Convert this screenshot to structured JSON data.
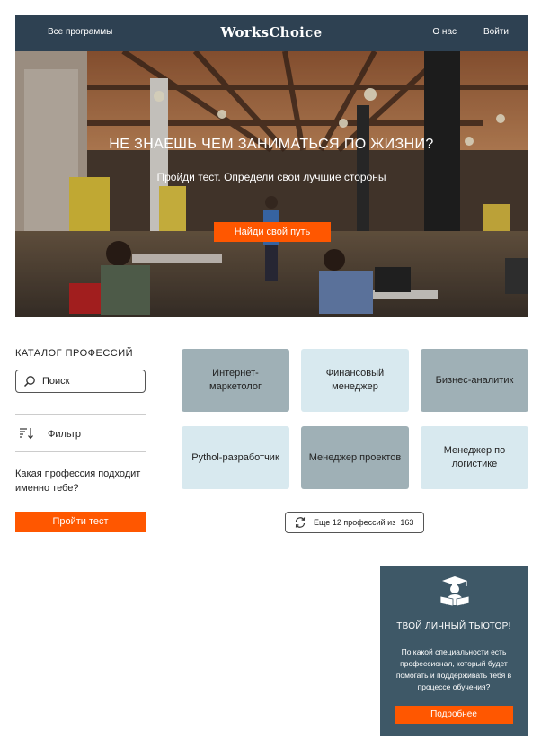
{
  "nav": {
    "all_programs": "Все программы",
    "logo": "WorksChoice",
    "about": "О нас",
    "login": "Войти"
  },
  "hero": {
    "title": "НЕ ЗНАЕШЬ ЧЕМ ЗАНИМАТЬСЯ ПО ЖИЗНИ?",
    "subtitle": "Пройди тест. Определи свои лучшие стороны",
    "cta": "Найди свой путь"
  },
  "sidebar": {
    "catalog_title": "КАТАЛОГ ПРОФЕССИЙ",
    "search_placeholder": "Поиск",
    "filter_label": "Фильтр",
    "question": "Какая профессия подходит именно тебе?",
    "test_button": "Пройти тест"
  },
  "professions": [
    {
      "label": "Интернет-маркетолог",
      "tone": "dark"
    },
    {
      "label": "Финансовый менеджер",
      "tone": "light"
    },
    {
      "label": "Бизнес-аналитик",
      "tone": "dark"
    },
    {
      "label": "Pythol-разработчик",
      "tone": "light"
    },
    {
      "label": "Менеджер проектов",
      "tone": "dark"
    },
    {
      "label": "Менеджер по логистике",
      "tone": "light"
    }
  ],
  "more_button": {
    "label": "Еще 12 профессий из",
    "total": "163"
  },
  "tutor": {
    "title": "ТВОЙ ЛИЧНЫЙ ТЬЮТОР!",
    "body": "По какой специальности есть профессионал, который будет помогать и поддерживать тебя в процессе обучения?",
    "button": "Подробнее"
  },
  "colors": {
    "nav_bg": "#2e4152",
    "accent": "#ff5700",
    "card_dark": "#9fb0b6",
    "card_light": "#d8e9ef",
    "tutor_bg": "#3e5867"
  },
  "icons": [
    "search-icon",
    "filter-sort-icon",
    "refresh-icon",
    "tutor-icon"
  ]
}
